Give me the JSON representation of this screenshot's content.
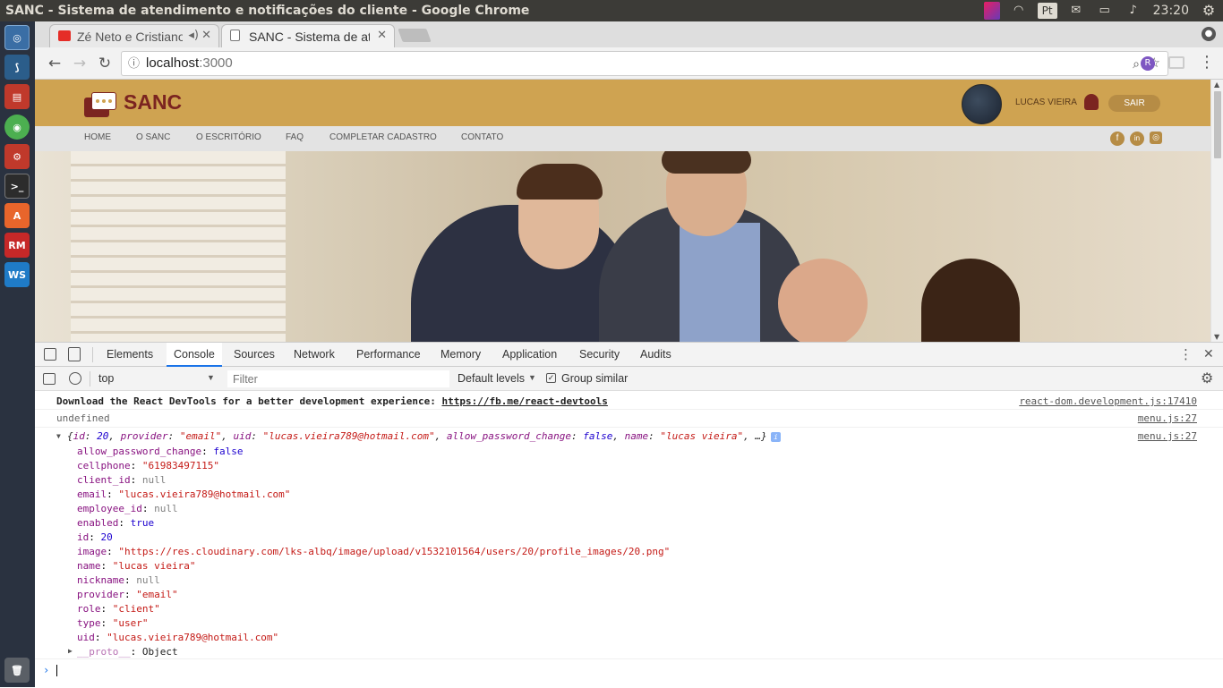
{
  "os": {
    "window_title": "SANC - Sistema de atendimento e notificações do cliente - Google Chrome",
    "keyboard_layout": "Pt",
    "clock": "23:20",
    "launcher": [
      {
        "name": "dash-icon",
        "color": "#3a6ea5",
        "glyph": "◎"
      },
      {
        "name": "mysql-workbench-icon",
        "color": "#2b5d8a",
        "glyph": "⟆"
      },
      {
        "name": "files-icon",
        "color": "#c0392b",
        "glyph": "▤"
      },
      {
        "name": "chrome-icon",
        "color": "#4caf50",
        "glyph": "◉"
      },
      {
        "name": "settings-icon",
        "color": "#c0392b",
        "glyph": "⚙"
      },
      {
        "name": "terminal-icon",
        "color": "#2c2c2c",
        "glyph": ">_"
      },
      {
        "name": "software-center-icon",
        "color": "#e8652b",
        "glyph": "A"
      },
      {
        "name": "rubymine-icon",
        "color": "#c62828",
        "glyph": "RM"
      },
      {
        "name": "webstorm-icon",
        "color": "#1f7bc7",
        "glyph": "WS"
      }
    ],
    "trash": "trash-icon"
  },
  "browser": {
    "tabs": [
      {
        "title": "Zé Neto e Cristiano",
        "active": false
      },
      {
        "title": "SANC - Sistema de atendimento",
        "active": true
      }
    ],
    "url_host": "localhost",
    "url_port": ":3000"
  },
  "site": {
    "brand": "SANC",
    "user_name": "LUCAS VIEIRA",
    "logout_label": "SAIR",
    "nav": [
      "HOME",
      "O SANC",
      "O ESCRITÓRIO",
      "FAQ",
      "COMPLETAR CADASTRO",
      "CONTATO"
    ],
    "social": [
      "f",
      "in",
      "◎"
    ]
  },
  "devtools": {
    "tabs": [
      "Elements",
      "Console",
      "Sources",
      "Network",
      "Performance",
      "Memory",
      "Application",
      "Security",
      "Audits"
    ],
    "active_tab": "Console",
    "context": "top",
    "filter_placeholder": "Filter",
    "levels": "Default levels",
    "group_similar": "Group similar",
    "messages": {
      "react_devtools_text": "Download the React DevTools for a better development experience: ",
      "react_devtools_link": "https://fb.me/react-devtools",
      "react_devtools_source": "react-dom.development.js:17410",
      "undefined_text": "undefined",
      "undefined_source": "menu.js:27",
      "object_source": "menu.js:27",
      "object_preview_open": "{",
      "object_preview_id_key": "id",
      "object_preview_id_val": "20",
      "object_preview_provider_key": "provider",
      "object_preview_provider_val": "\"email\"",
      "object_preview_uid_key": "uid",
      "object_preview_uid_val": "\"lucas.vieira789@hotmail.com\"",
      "object_preview_apc_key": "allow_password_change",
      "object_preview_apc_val": "false",
      "object_preview_name_key": "name",
      "object_preview_name_val": "\"lucas vieira\"",
      "object_preview_close": ", …}",
      "properties": [
        {
          "key": "allow_password_change",
          "value": "false",
          "type": "bool"
        },
        {
          "key": "cellphone",
          "value": "\"61983497115\"",
          "type": "str"
        },
        {
          "key": "client_id",
          "value": "null",
          "type": "null"
        },
        {
          "key": "email",
          "value": "\"lucas.vieira789@hotmail.com\"",
          "type": "str"
        },
        {
          "key": "employee_id",
          "value": "null",
          "type": "null"
        },
        {
          "key": "enabled",
          "value": "true",
          "type": "bool"
        },
        {
          "key": "id",
          "value": "20",
          "type": "num"
        },
        {
          "key": "image",
          "value": "\"https://res.cloudinary.com/lks-albq/image/upload/v1532101564/users/20/profile_images/20.png\"",
          "type": "str"
        },
        {
          "key": "name",
          "value": "\"lucas vieira\"",
          "type": "str"
        },
        {
          "key": "nickname",
          "value": "null",
          "type": "null"
        },
        {
          "key": "provider",
          "value": "\"email\"",
          "type": "str"
        },
        {
          "key": "role",
          "value": "\"client\"",
          "type": "str"
        },
        {
          "key": "type",
          "value": "\"user\"",
          "type": "str"
        },
        {
          "key": "uid",
          "value": "\"lucas.vieira789@hotmail.com\"",
          "type": "str"
        }
      ],
      "proto_key": "__proto__",
      "proto_value": "Object"
    }
  }
}
